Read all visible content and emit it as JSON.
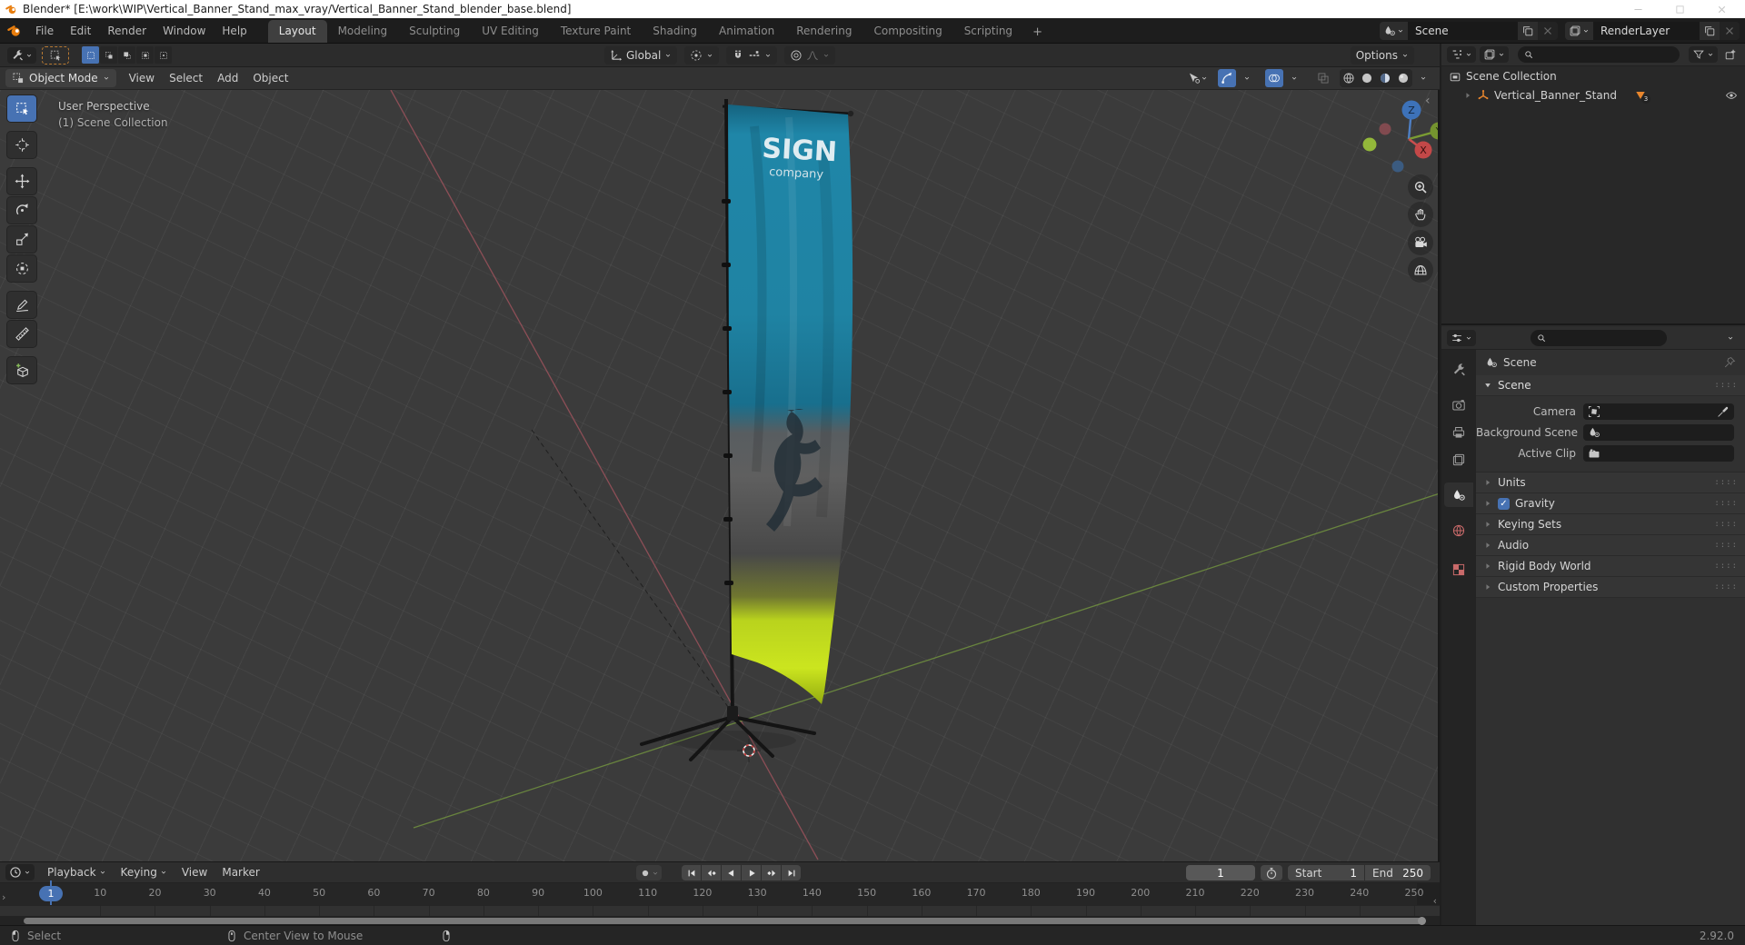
{
  "window": {
    "title": "Blender* [E:\\work\\WIP\\Vertical_Banner_Stand_max_vray/Vertical_Banner_Stand_blender_base.blend]"
  },
  "topbar": {
    "menus": [
      "File",
      "Edit",
      "Render",
      "Window",
      "Help"
    ],
    "workspaces": [
      {
        "label": "Layout",
        "active": true
      },
      {
        "label": "Modeling"
      },
      {
        "label": "Sculpting"
      },
      {
        "label": "UV Editing"
      },
      {
        "label": "Texture Paint"
      },
      {
        "label": "Shading"
      },
      {
        "label": "Animation"
      },
      {
        "label": "Rendering"
      },
      {
        "label": "Compositing"
      },
      {
        "label": "Scripting"
      }
    ],
    "add_workspace": "+",
    "scene": {
      "value": "Scene"
    },
    "render_layer": {
      "value": "RenderLayer"
    }
  },
  "tool_settings": {
    "orientation": "Global",
    "options": "Options",
    "select_modes": [
      {
        "icon": "mode-new",
        "active": true
      },
      {
        "icon": "mode-extend"
      },
      {
        "icon": "mode-subtract"
      },
      {
        "icon": "mode-invert"
      },
      {
        "icon": "mode-intersect"
      }
    ]
  },
  "viewport": {
    "mode": "Object Mode",
    "menus": [
      "View",
      "Select",
      "Add",
      "Object"
    ],
    "overlay": {
      "line1": "User Perspective",
      "line2": "(1) Scene Collection"
    },
    "gizmo": {
      "z": "Z",
      "y": "Y",
      "x": "X"
    },
    "banner": {
      "title": "SIGN",
      "subtitle": "company"
    },
    "tools": [
      {
        "icon": "select-box",
        "name": "select-box-tool",
        "active": true
      },
      {
        "icon": "cursor-tool",
        "name": "cursor-tool"
      },
      {
        "icon": "move-tool",
        "name": "move-tool"
      },
      {
        "icon": "rotate-tool",
        "name": "rotate-tool"
      },
      {
        "icon": "scale-tool",
        "name": "scale-tool"
      },
      {
        "icon": "transform-tool",
        "name": "transform-tool"
      },
      {
        "icon": "annotate-tool",
        "name": "annotate-tool"
      },
      {
        "icon": "measure-tool",
        "name": "measure-tool"
      },
      {
        "icon": "addcube-tool",
        "name": "add-cube-tool"
      }
    ],
    "shading": [
      {
        "icon": "shade-wire"
      },
      {
        "icon": "shade-solid"
      },
      {
        "icon": "shade-material",
        "active": true
      },
      {
        "icon": "shade-render"
      }
    ]
  },
  "outliner": {
    "root": "Scene Collection",
    "object": {
      "name": "Vertical_Banner_Stand",
      "badge": "3"
    }
  },
  "properties": {
    "breadcrumb": "Scene",
    "tabs": [
      {
        "icon": "tab-tool"
      },
      {
        "icon": "tab-render"
      },
      {
        "icon": "tab-output"
      },
      {
        "icon": "tab-viewlayer"
      },
      {
        "icon": "tab-scene",
        "active": true
      },
      {
        "icon": "tab-world",
        "cls": "tint"
      },
      {
        "icon": "tab-texture",
        "cls": "tint"
      }
    ],
    "scene_panel": {
      "title": "Scene",
      "rows": [
        {
          "label": "Camera",
          "icon": "camera-data",
          "eyedropper": true
        },
        {
          "label": "Background Scene",
          "icon": "scene-data"
        },
        {
          "label": "Active Clip",
          "icon": "clip-data"
        }
      ]
    },
    "panels": [
      {
        "label": "Units"
      },
      {
        "label": "Gravity",
        "checkbox": true
      },
      {
        "label": "Keying Sets"
      },
      {
        "label": "Audio"
      },
      {
        "label": "Rigid Body World"
      },
      {
        "label": "Custom Properties"
      }
    ]
  },
  "timeline": {
    "menus": [
      {
        "label": "Playback",
        "caret": true
      },
      {
        "label": "Keying",
        "caret": true
      },
      {
        "label": "View"
      },
      {
        "label": "Marker"
      }
    ],
    "transport": [
      "jump-start",
      "prev-key",
      "play-rev",
      "play",
      "next-key",
      "jump-end"
    ],
    "current_frame": "1",
    "start_label": "Start",
    "start_value": "1",
    "end_label": "End",
    "end_value": "250",
    "ruler_labels": [
      10,
      20,
      30,
      40,
      50,
      60,
      70,
      80,
      90,
      100,
      110,
      120,
      130,
      140,
      150,
      160,
      170,
      180,
      190,
      200,
      210,
      220,
      230,
      240,
      250
    ]
  },
  "status": {
    "select": "Select",
    "center": "Center View to Mouse",
    "version": "2.92.0"
  },
  "colors": {
    "accent": "#4772b3",
    "object_orange": "#e8862d",
    "banner_teal": "#1f83a3",
    "banner_gray": "#565656",
    "banner_green": "#c6df1f"
  }
}
